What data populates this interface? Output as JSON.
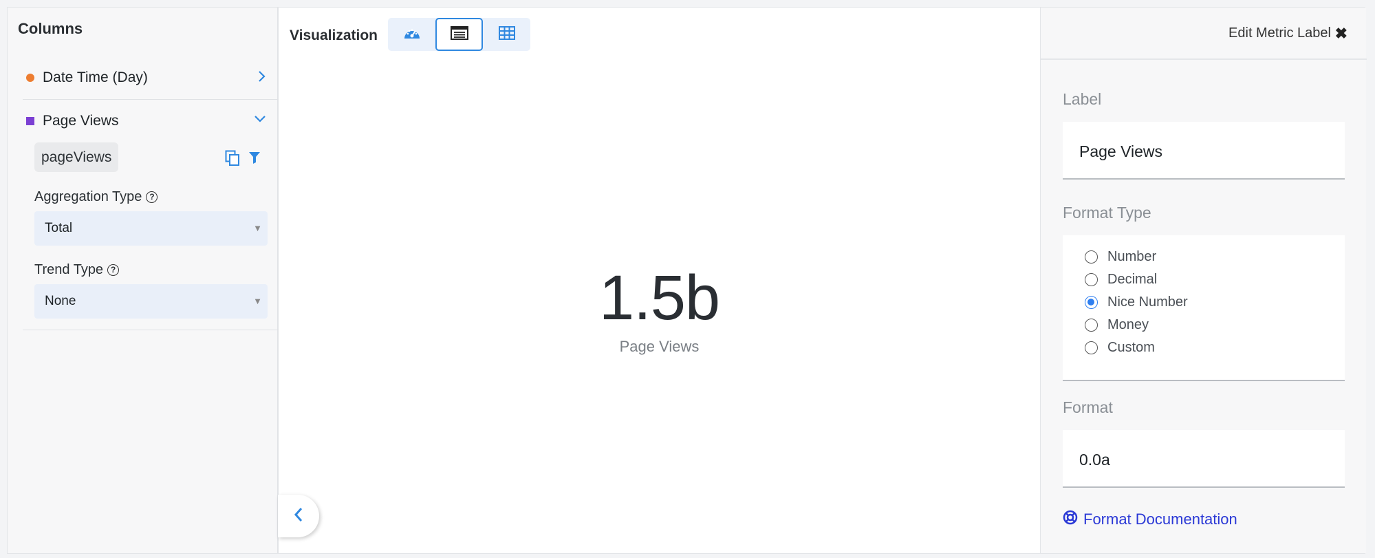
{
  "columns_panel": {
    "title": "Columns",
    "items": [
      {
        "label": "Date Time (Day)",
        "color": "#ed7d31",
        "marker": "circle"
      },
      {
        "label": "Page Views",
        "color": "#7b3fd3",
        "marker": "square"
      }
    ],
    "metric": {
      "field": "pageViews",
      "aggregation_label": "Aggregation Type",
      "aggregation_value": "Total",
      "trend_label": "Trend Type",
      "trend_value": "None"
    }
  },
  "visualization": {
    "title": "Visualization",
    "buttons": [
      "gauge-icon",
      "metric-icon",
      "table-icon"
    ],
    "active": "metric-icon",
    "metric_value": "1.5b",
    "metric_label": "Page Views"
  },
  "editor": {
    "title": "Edit Metric Label",
    "label_heading": "Label",
    "label_value": "Page Views",
    "format_type_heading": "Format Type",
    "format_options": [
      {
        "label": "Number",
        "checked": false
      },
      {
        "label": "Decimal",
        "checked": false
      },
      {
        "label": "Nice Number",
        "checked": true
      },
      {
        "label": "Money",
        "checked": false
      },
      {
        "label": "Custom",
        "checked": false
      }
    ],
    "format_heading": "Format",
    "format_value": "0.0a",
    "doc_link": "Format Documentation"
  },
  "colors": {
    "accent": "#2f88e0",
    "link": "#2b39d6",
    "radio": "#2f7ff0"
  }
}
